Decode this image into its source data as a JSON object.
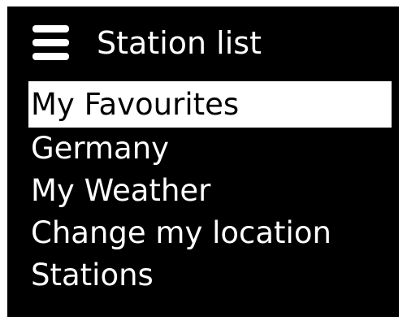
{
  "header": {
    "title": "Station list",
    "icon": "hamburger-menu-icon"
  },
  "menu": {
    "items": [
      {
        "label": "My Favourites",
        "selected": true
      },
      {
        "label": "Germany",
        "selected": false
      },
      {
        "label": "My Weather",
        "selected": false
      },
      {
        "label": "Change my location",
        "selected": false
      },
      {
        "label": "Stations",
        "selected": false
      }
    ]
  },
  "colors": {
    "background": "#000000",
    "text": "#ffffff",
    "highlight": "#ffffff",
    "highlight_text": "#000000"
  }
}
